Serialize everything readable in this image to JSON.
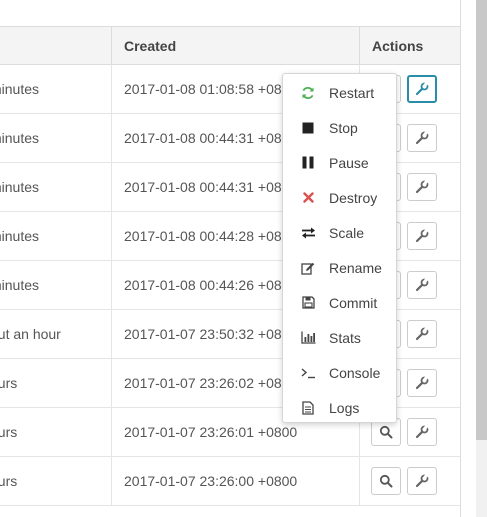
{
  "table": {
    "headers": {
      "created": "Created",
      "actions": "Actions"
    },
    "rows": [
      {
        "status": "minutes",
        "created": "2017-01-08 01:08:58 +0800"
      },
      {
        "status": "minutes",
        "created": "2017-01-08 00:44:31 +0800"
      },
      {
        "status": "minutes",
        "created": "2017-01-08 00:44:31 +0800"
      },
      {
        "status": "minutes",
        "created": "2017-01-08 00:44:28 +0800"
      },
      {
        "status": "minutes",
        "created": "2017-01-08 00:44:26 +0800"
      },
      {
        "status": "out an hour",
        "created": "2017-01-07 23:50:32 +0800"
      },
      {
        "status": "ours",
        "created": "2017-01-07 23:26:02 +0800"
      },
      {
        "status": "ours",
        "created": "2017-01-07 23:26:01 +0800"
      },
      {
        "status": "ours",
        "created": "2017-01-07 23:26:00 +0800"
      }
    ]
  },
  "menu": {
    "items": [
      {
        "label": "Restart",
        "icon": "refresh-icon",
        "color": "#4caf50"
      },
      {
        "label": "Stop",
        "icon": "stop-icon",
        "color": "#222222"
      },
      {
        "label": "Pause",
        "icon": "pause-icon",
        "color": "#222222"
      },
      {
        "label": "Destroy",
        "icon": "close-icon",
        "color": "#d9534f"
      },
      {
        "label": "Scale",
        "icon": "exchange-icon",
        "color": "#222222"
      },
      {
        "label": "Rename",
        "icon": "edit-icon",
        "color": "#444444"
      },
      {
        "label": "Commit",
        "icon": "save-icon",
        "color": "#444444"
      },
      {
        "label": "Stats",
        "icon": "bar-chart-icon",
        "color": "#444444"
      },
      {
        "label": "Console",
        "icon": "terminal-icon",
        "color": "#444444"
      },
      {
        "label": "Logs",
        "icon": "file-text-icon",
        "color": "#444444"
      }
    ]
  },
  "colors": {
    "accent": "#2a8ca8",
    "header_bg": "#f4f4f4",
    "border": "#dcdcdc"
  }
}
